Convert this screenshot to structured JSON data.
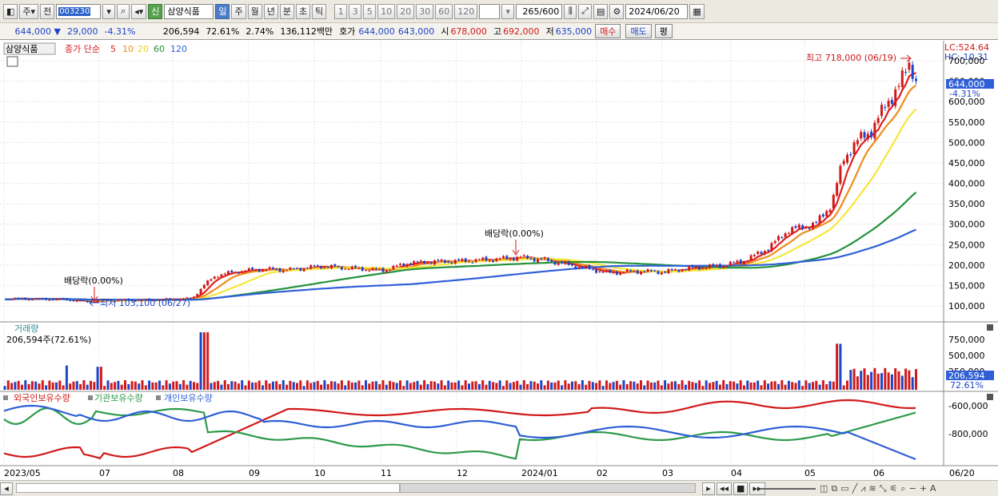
{
  "toolbar": {
    "market": "주",
    "prev": "전",
    "code": "003230",
    "badge": "신",
    "name": "삼양식품",
    "periods": [
      "일",
      "주",
      "월",
      "년",
      "분",
      "초",
      "틱"
    ],
    "numbers": [
      "1",
      "3",
      "5",
      "10",
      "20",
      "30",
      "60",
      "120"
    ],
    "count": "265",
    "count_total": "/600",
    "date": "2024/06/20"
  },
  "quote": {
    "price": "644,000",
    "arrow": "▼",
    "change": "29,000",
    "rate": "-4.31%",
    "volume": "206,594",
    "vol_rate": "72.61%",
    "turnover": "2.74%",
    "amount": "136,112백만",
    "bid_label": "호가",
    "bid1": "644,000",
    "bid2": "643,000",
    "open_label": "시",
    "open": "678,000",
    "high_label": "고",
    "high": "692,000",
    "low_label": "저",
    "low": "635,000",
    "buy": "매수",
    "sell": "매도",
    "eval": "평"
  },
  "price_panel": {
    "stock_tab": "삼양식품",
    "ma_label": "종가 단순",
    "ma_periods": [
      "5",
      "10",
      "20",
      "60",
      "120"
    ],
    "ma_colors": [
      "#e02020",
      "#f08c1c",
      "#f5e63a",
      "#23923a",
      "#3060d8"
    ],
    "lc": "LC:524.64",
    "hc": "HC:-10.31",
    "high_annotation": "최고 718,000 (06/19)",
    "low_annotation": "최저 103,100 (06/27)",
    "dividend1": "배당락(0.00%)",
    "dividend2": "배당락(0.00%)",
    "current_price_tag": "644,000",
    "current_rate_tag": "-4.31%",
    "y_ticks": [
      "700,000",
      "650,000",
      "600,000",
      "550,000",
      "500,000",
      "450,000",
      "400,000",
      "350,000",
      "300,000",
      "250,000",
      "200,000",
      "150,000",
      "100,000"
    ]
  },
  "volume_panel": {
    "title": "거래량",
    "value": "206,594주(72.61%)",
    "y_ticks": [
      "750,000",
      "500,000",
      "250,000"
    ],
    "tag_value": "206,594",
    "tag_rate": "72.61%"
  },
  "holding_panel": {
    "legends": [
      {
        "label": "외국인보유수량",
        "color": "#d21a1a"
      },
      {
        "label": "기관보유수량",
        "color": "#2e9a4a"
      },
      {
        "label": "개인보유수량",
        "color": "#2f5fd6"
      }
    ],
    "y_ticks": [
      "-600,000",
      "-800,000"
    ]
  },
  "x_axis": {
    "labels": [
      "2023/05",
      "07",
      "08",
      "09",
      "10",
      "11",
      "12",
      "2024/01",
      "02",
      "03",
      "04",
      "05",
      "06"
    ],
    "end_label": "06/20"
  },
  "bottom": {
    "icons": [
      "play-icon",
      "first-icon",
      "stop-icon",
      "last-icon"
    ]
  }
}
